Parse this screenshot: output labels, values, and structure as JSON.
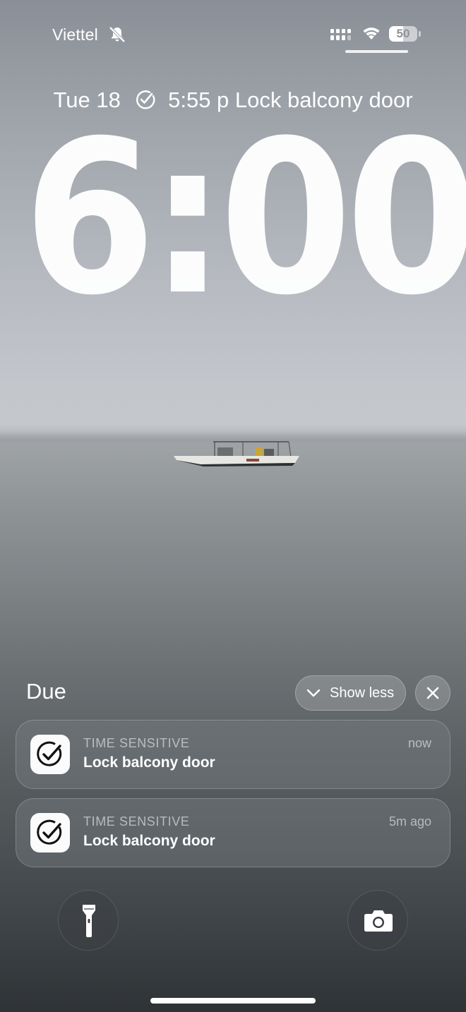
{
  "status_bar": {
    "carrier": "Viettel",
    "battery_level": 50,
    "battery_text": "50",
    "icons": [
      "bell-slash-icon",
      "cellular-signal-icon",
      "wifi-icon",
      "battery-icon"
    ]
  },
  "lock_screen": {
    "date": "Tue 18",
    "widget_time": "5:55 p",
    "widget_label": "Lock balcony door",
    "widget_icon": "checkmark-circle-icon",
    "clock": "6:00"
  },
  "notifications": {
    "group_title": "Due",
    "show_less_label": "Show less",
    "items": [
      {
        "category": "TIME SENSITIVE",
        "title": "Lock balcony door",
        "time": "now",
        "icon": "reminder-check-icon"
      },
      {
        "category": "TIME SENSITIVE",
        "title": "Lock balcony door",
        "time": "5m ago",
        "icon": "reminder-check-icon"
      }
    ]
  },
  "quick_actions": {
    "left_icon": "flashlight-icon",
    "right_icon": "camera-icon"
  },
  "colors": {
    "text": "#ffffff",
    "secondary_text": "#ebeef0",
    "app_icon_bg": "#fbfbfb",
    "app_icon_glyph": "#111111"
  }
}
